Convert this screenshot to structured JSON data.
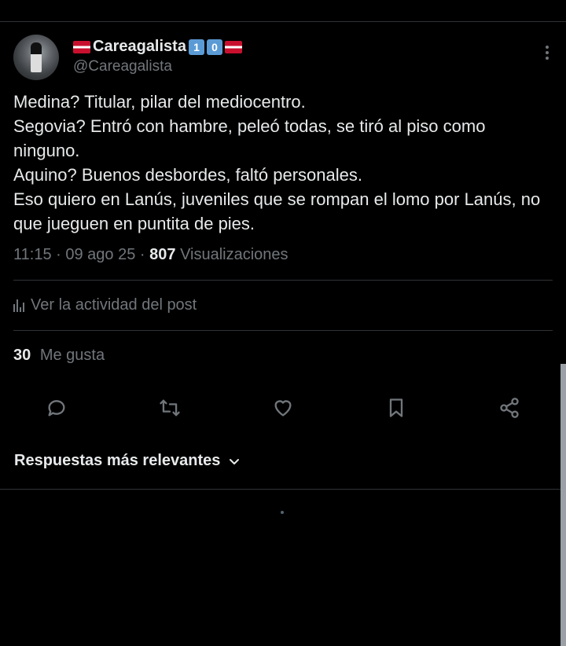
{
  "author": {
    "display_name": "Careagalista",
    "keycap_1": "1",
    "keycap_2": "0",
    "handle": "@Careagalista"
  },
  "tweet": {
    "lines": [
      "Medina? Titular, pilar del mediocentro.",
      "Segovia? Entró con hambre, peleó todas, se tiró al piso como ninguno.",
      "Aquino? Buenos desbordes, faltó personales.",
      "Eso quiero en Lanús, juveniles que se rompan el lomo por Lanús, no que jueguen en puntita de pies."
    ]
  },
  "meta": {
    "time": "11:15",
    "date": "09 ago 25",
    "views_count": "807",
    "views_label": "Visualizaciones"
  },
  "activity": {
    "label": "Ver la actividad del post"
  },
  "likes": {
    "count": "30",
    "label": "Me gusta"
  },
  "actions": [
    "reply-icon",
    "retweet-icon",
    "like-icon",
    "bookmark-icon",
    "share-icon"
  ],
  "replies": {
    "sort_label": "Respuestas más relevantes"
  },
  "colors": {
    "background": "#000000",
    "text": "#e7e9ea",
    "secondary": "#71767b",
    "divider": "#2f3336"
  }
}
